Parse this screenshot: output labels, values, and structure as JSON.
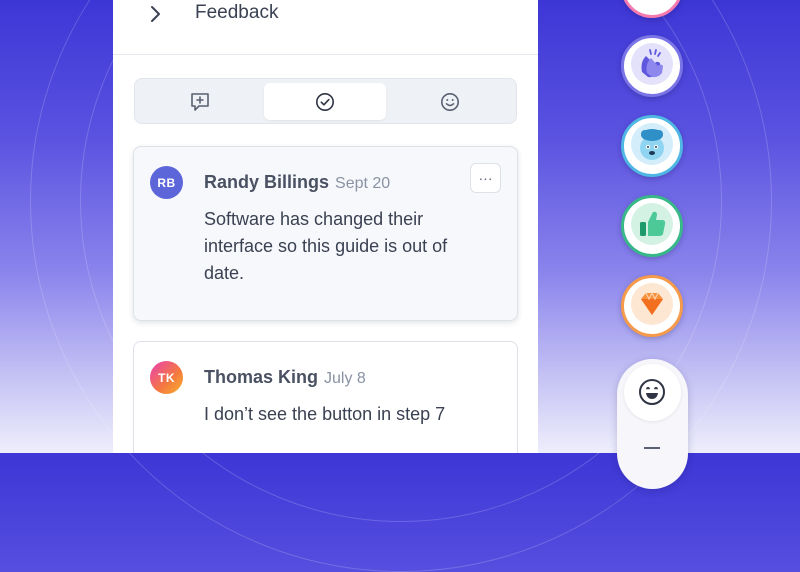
{
  "header": {
    "title": "Feedback"
  },
  "tabs": [
    {
      "name": "add-comment",
      "icon": "comment-plus-icon",
      "active": false
    },
    {
      "name": "resolved",
      "icon": "check-circle-icon",
      "active": true
    },
    {
      "name": "reactions",
      "icon": "smiley-icon",
      "active": false
    }
  ],
  "comments": [
    {
      "initials": "RB",
      "author": "Randy Billings",
      "date": "Sept 20",
      "text": "Software has changed their interface so this guide is out of date.",
      "more_label": "···"
    },
    {
      "initials": "TK",
      "author": "Thomas King",
      "date": "July 8",
      "text": "I don’t see the button in step 7"
    }
  ],
  "reactions": [
    {
      "icon": "clapping-hands-icon",
      "ring": "#7b74e6"
    },
    {
      "icon": "mind-blown-icon",
      "ring": "#4fb7e3"
    },
    {
      "icon": "thumbs-up-icon",
      "ring": "#38b889"
    },
    {
      "icon": "gem-icon",
      "ring": "#f59a4a"
    }
  ],
  "colors": {
    "accent": "#4b44d9",
    "panel_bg": "#ffffff",
    "card_bg": "#f6f8fb"
  }
}
